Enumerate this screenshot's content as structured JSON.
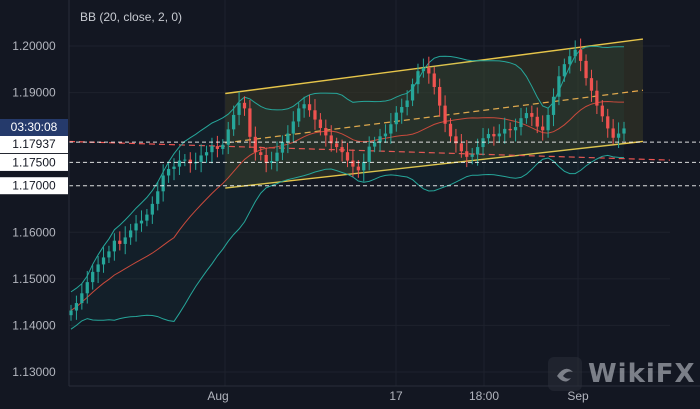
{
  "indicator_label": "BB (20, close, 2, 0)",
  "countdown": "03:30:08",
  "current_price_label": "1.17937",
  "watermark_text": "WikiFX",
  "colors": {
    "background": "#131722",
    "grid": "#1e222d",
    "up_candle": "#26a69a",
    "down_candle": "#ef5350",
    "bollinger_bands": "#26a69a",
    "bollinger_basis": "#c94a3c",
    "channel": "#e6c54a",
    "channel_fill": "#3a3a26",
    "level_line": "#ffffff",
    "red_dashed": "#ef5350"
  },
  "chart_data": {
    "type": "candlestick",
    "title": "",
    "indicator": "BB (20, close, 2, 0)",
    "x_tick_labels": [
      "Aug",
      "17",
      "18:00",
      "Sep"
    ],
    "y_tick_labels": [
      "1.20000",
      "1.19000",
      "1.17500",
      "1.17000",
      "1.16000",
      "1.15000",
      "1.14000",
      "1.13000"
    ],
    "ylim": [
      1.1275,
      1.2075
    ],
    "grid": true,
    "horizontal_levels": [
      {
        "price": 1.17937,
        "style": "dashed",
        "color": "#ffffff",
        "label": "1.17937"
      },
      {
        "price": 1.175,
        "style": "dashed",
        "color": "#ffffff",
        "label": "1.17500"
      },
      {
        "price": 1.17,
        "style": "dashed",
        "color": "#ffffff",
        "label": "1.17000"
      }
    ],
    "ascending_channel": {
      "upper": [
        [
          0.26,
          1.1898
        ],
        [
          0.955,
          1.2015
        ]
      ],
      "lower": [
        [
          0.26,
          1.1695
        ],
        [
          0.955,
          1.1795
        ]
      ],
      "mid": [
        [
          0.26,
          1.1792
        ],
        [
          0.955,
          1.1905
        ]
      ]
    },
    "red_dashed_line": [
      [
        0.0,
        1.1795
      ],
      [
        1.0,
        1.1755
      ]
    ],
    "closes": [
      1.1432,
      1.1448,
      1.1469,
      1.1493,
      1.1515,
      1.1531,
      1.1546,
      1.1559,
      1.1582,
      1.1575,
      1.1589,
      1.1604,
      1.1619,
      1.1625,
      1.1638,
      1.1661,
      1.1688,
      1.1722,
      1.1736,
      1.1741,
      1.1754,
      1.1756,
      1.1748,
      1.1751,
      1.1765,
      1.1772,
      1.1785,
      1.1779,
      1.1788,
      1.1821,
      1.1852,
      1.1878,
      1.1866,
      1.1805,
      1.1772,
      1.1766,
      1.1749,
      1.1753,
      1.1771,
      1.1794,
      1.1812,
      1.1838,
      1.1866,
      1.1875,
      1.1862,
      1.1842,
      1.1824,
      1.1808,
      1.1791,
      1.1783,
      1.1772,
      1.1754,
      1.1741,
      1.1733,
      1.1751,
      1.1784,
      1.1793,
      1.1806,
      1.1812,
      1.1832,
      1.1857,
      1.1869,
      1.1883,
      1.1918,
      1.1946,
      1.1953,
      1.1941,
      1.1912,
      1.1872,
      1.1833,
      1.1806,
      1.1791,
      1.1774,
      1.1762,
      1.1767,
      1.1783,
      1.1802,
      1.1811,
      1.1806,
      1.1812,
      1.1822,
      1.1819,
      1.1826,
      1.1845,
      1.1856,
      1.1848,
      1.1827,
      1.1819,
      1.1852,
      1.1891,
      1.1935,
      1.1961,
      1.1978,
      1.1992,
      1.1968,
      1.1931,
      1.1904,
      1.1872,
      1.1849,
      1.1823,
      1.1803,
      1.1812,
      1.1823
    ]
  },
  "watermark": "WikiFX"
}
